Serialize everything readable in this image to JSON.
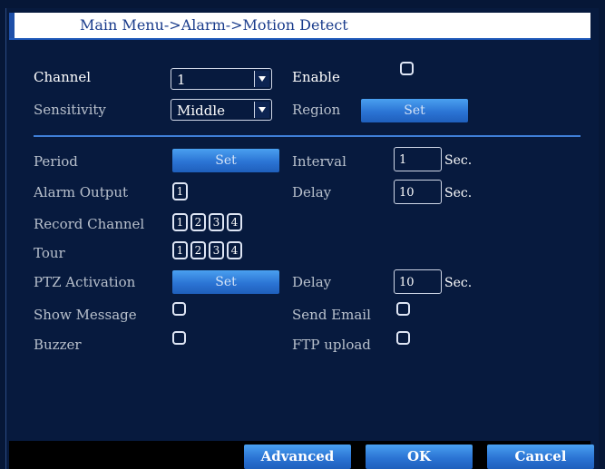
{
  "window": {
    "title": "Main Menu->Alarm->Motion Detect"
  },
  "form": {
    "channel": {
      "label": "Channel",
      "value": "1"
    },
    "enable": {
      "label": "Enable",
      "checked": false
    },
    "sensitivity": {
      "label": "Sensitivity",
      "value": "Middle"
    },
    "region": {
      "label": "Region",
      "button": "Set"
    },
    "period": {
      "label": "Period",
      "button": "Set"
    },
    "interval": {
      "label": "Interval",
      "value": "1",
      "unit": "Sec."
    },
    "alarm_output": {
      "label": "Alarm Output",
      "boxes": [
        "1"
      ]
    },
    "delay": {
      "label": "Delay",
      "value": "10",
      "unit": "Sec."
    },
    "record_channel": {
      "label": "Record Channel",
      "boxes": [
        "1",
        "2",
        "3",
        "4"
      ]
    },
    "tour": {
      "label": "Tour",
      "boxes": [
        "1",
        "2",
        "3",
        "4"
      ]
    },
    "ptz_activation": {
      "label": "PTZ Activation",
      "button": "Set"
    },
    "ptz_delay": {
      "label": "Delay",
      "value": "10",
      "unit": "Sec."
    },
    "show_message": {
      "label": "Show Message",
      "checked": false
    },
    "send_email": {
      "label": "Send Email",
      "checked": false
    },
    "buzzer": {
      "label": "Buzzer",
      "checked": false
    },
    "ftp_upload": {
      "label": "FTP upload",
      "checked": false
    }
  },
  "footer": {
    "advanced": "Advanced",
    "ok": "OK",
    "cancel": "Cancel"
  },
  "colors": {
    "background": "#071a3e",
    "button": "#2b74d4",
    "title_text": "#1a3c8c",
    "divider": "#3f7fd8"
  }
}
